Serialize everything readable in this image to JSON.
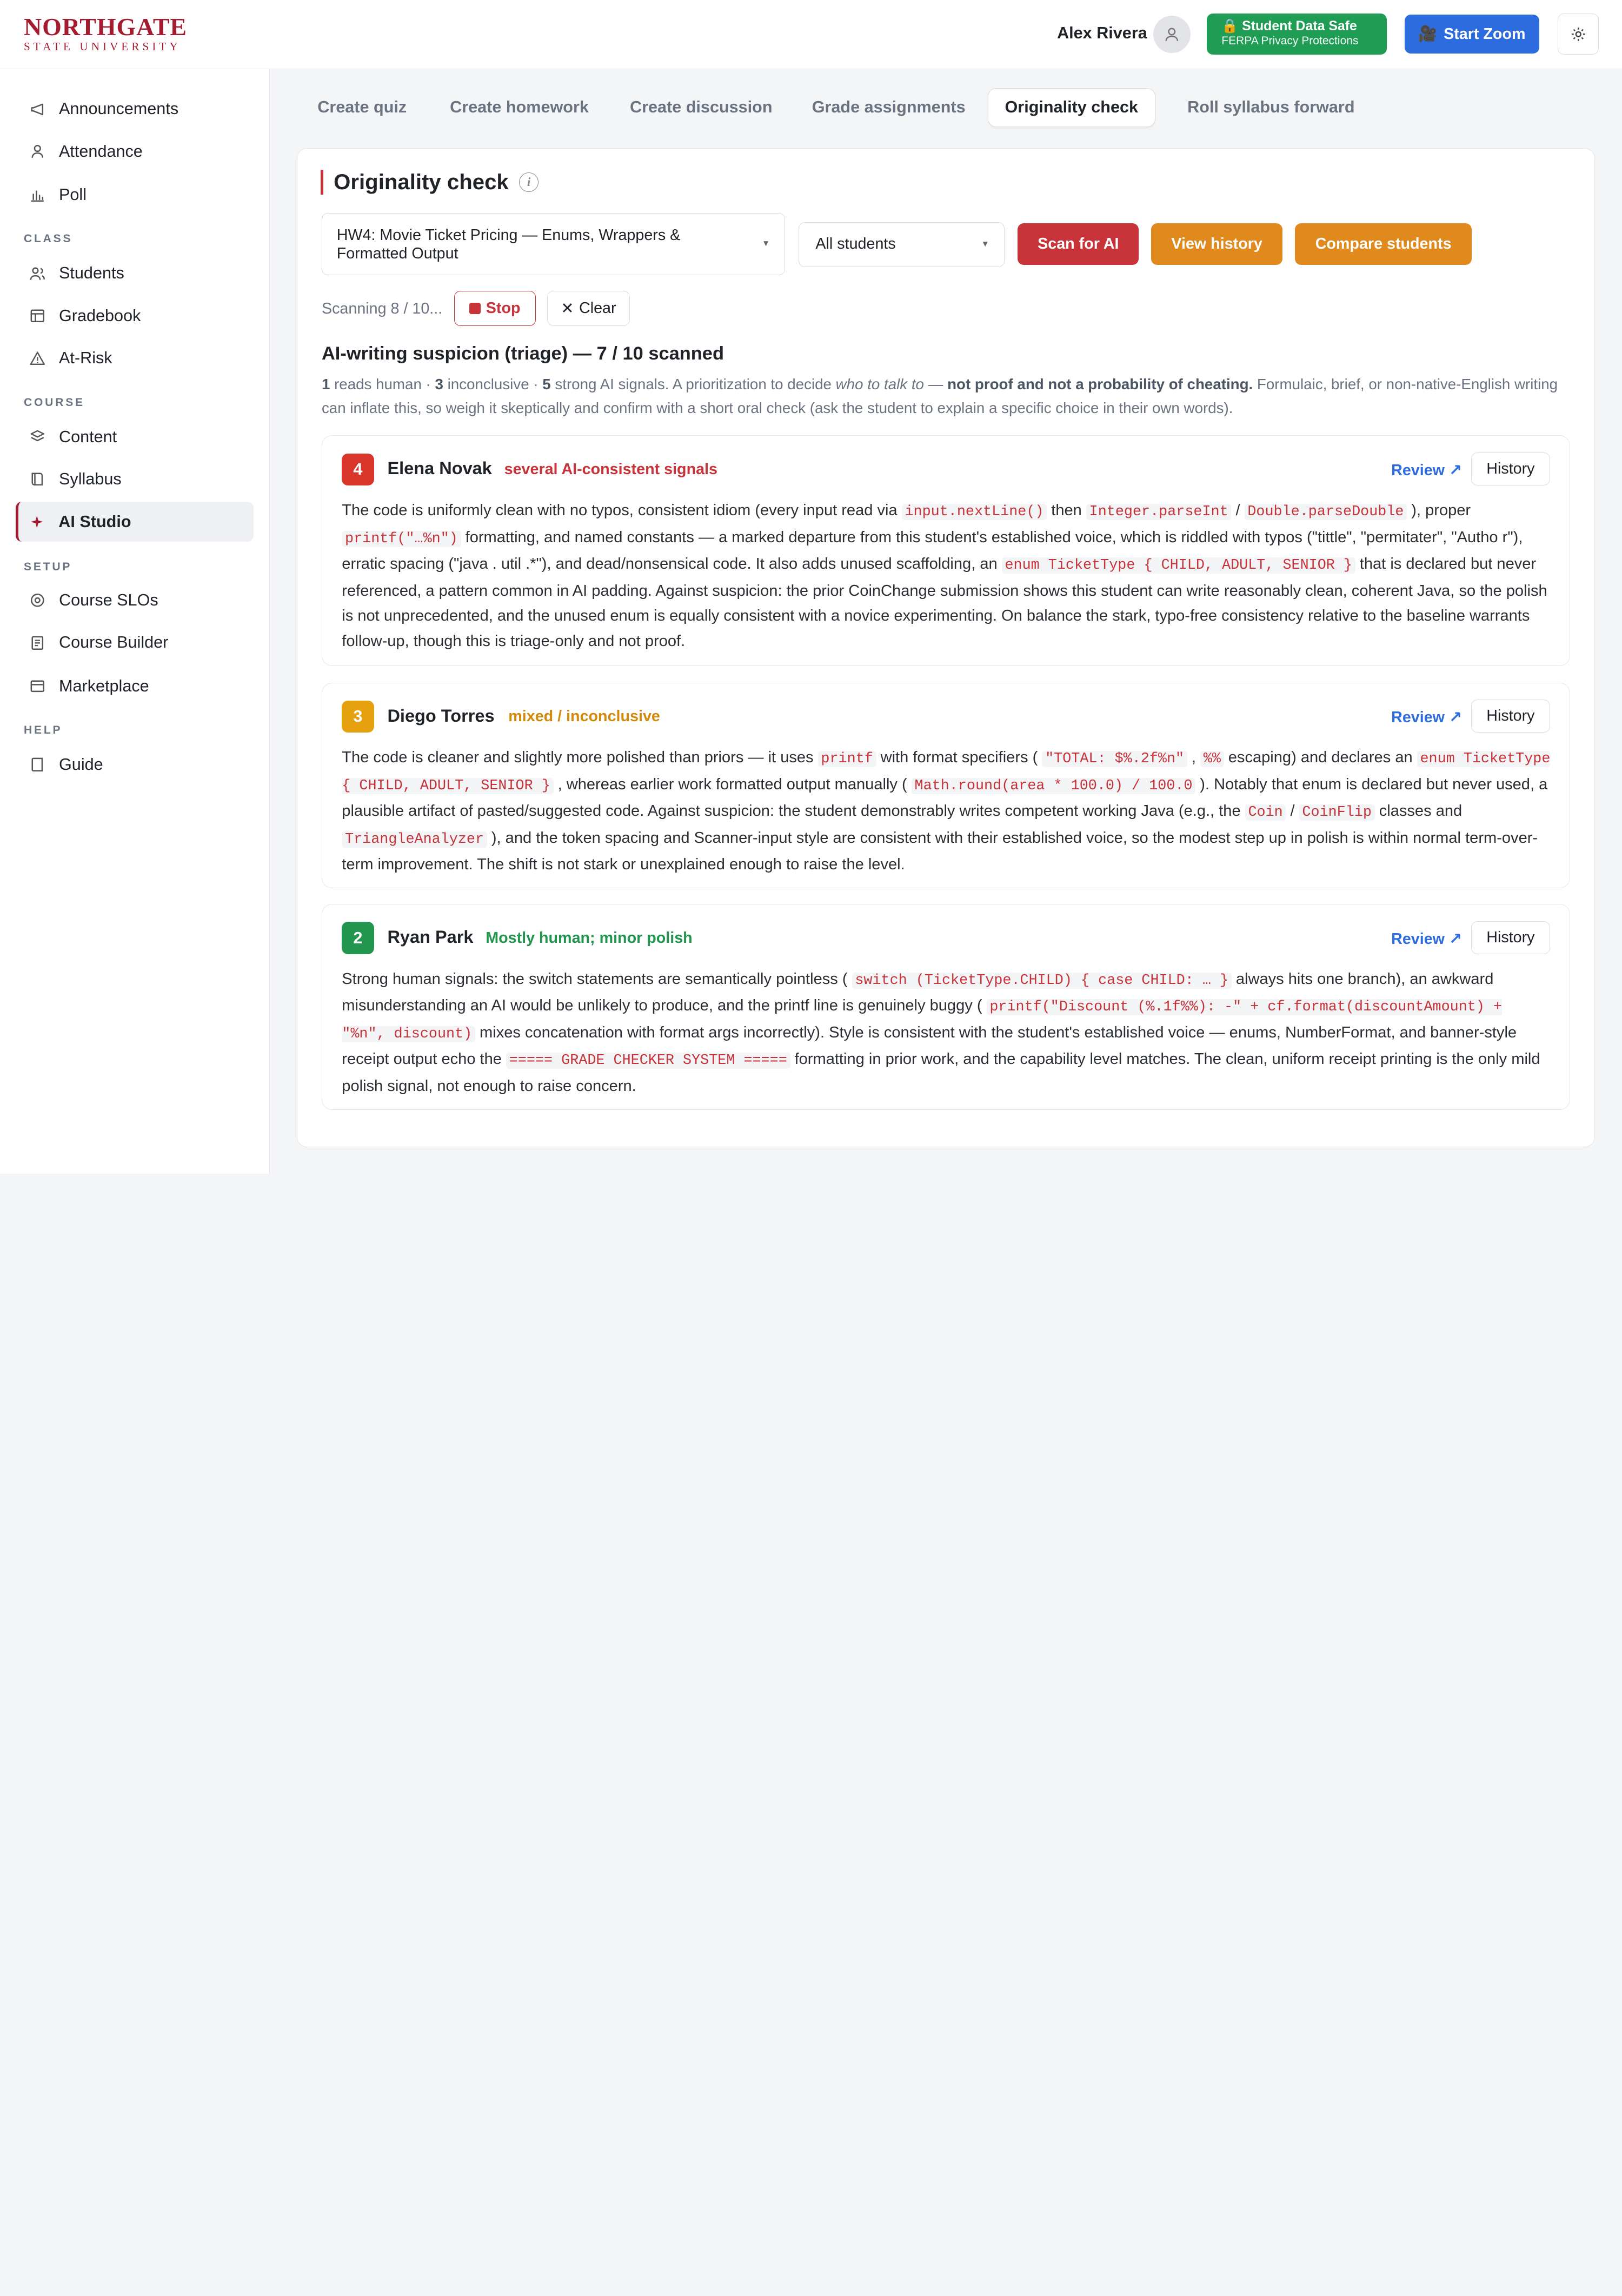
{
  "header": {
    "logo_main": "NORTHGATE",
    "logo_sub": "STATE UNIVERSITY",
    "user_name": "Alex Rivera",
    "ferpa_title": "🔒 Student Data Safe",
    "ferpa_sub": "FERPA Privacy Protections",
    "zoom_label": "Start Zoom"
  },
  "sidebar": {
    "top_items": [
      {
        "label": "Announcements",
        "icon": "megaphone-icon"
      },
      {
        "label": "Attendance",
        "icon": "person-icon"
      },
      {
        "label": "Poll",
        "icon": "bar-chart-icon"
      }
    ],
    "class_label": "CLASS",
    "class_items": [
      {
        "label": "Students",
        "icon": "people-icon"
      },
      {
        "label": "Gradebook",
        "icon": "table-icon"
      },
      {
        "label": "At-Risk",
        "icon": "warning-icon"
      }
    ],
    "course_label": "COURSE",
    "course_items": [
      {
        "label": "Content",
        "icon": "layers-icon"
      },
      {
        "label": "Syllabus",
        "icon": "book-icon"
      },
      {
        "label": "AI Studio",
        "icon": "sparkle-icon"
      }
    ],
    "setup_label": "SETUP",
    "setup_items": [
      {
        "label": "Course SLOs",
        "icon": "target-icon"
      },
      {
        "label": "Course Builder",
        "icon": "document-icon"
      },
      {
        "label": "Marketplace",
        "icon": "store-icon"
      }
    ],
    "help_label": "HELP",
    "help_items": [
      {
        "label": "Guide",
        "icon": "book-icon"
      }
    ]
  },
  "tabs": [
    "Create quiz",
    "Create homework",
    "Create discussion",
    "Grade assignments",
    "Originality check",
    "Roll syllabus forward"
  ],
  "active_tab": "Originality check",
  "main": {
    "title": "Originality check",
    "assignment_select": "HW4: Movie Ticket Pricing — Enums, Wrappers & Formatted Output",
    "student_select": "All students",
    "scan_btn": "Scan for AI",
    "history_btn": "View history",
    "compare_btn": "Compare students",
    "scan_status": "Scanning 8 / 10...",
    "stop_btn": "Stop",
    "clear_btn": "Clear",
    "triage_title": "AI-writing suspicion (triage) — 7 / 10 scanned",
    "triage_counts": {
      "human": "1",
      "human_label": "reads human",
      "inconclusive": "3",
      "inconclusive_label": "inconclusive",
      "strong": "5",
      "strong_label": "strong AI signals."
    },
    "triage_desc_1": "A prioritization to decide ",
    "triage_desc_em": "who to talk to",
    "triage_desc_2": " — ",
    "triage_desc_bold": "not proof and not a probability of cheating.",
    "triage_desc_3": " Formulaic, brief, or non-native-English writing can inflate this, so weigh it skeptically and confirm with a short oral check (ask the student to explain a specific choice in their own words)."
  },
  "results": [
    {
      "score": "4",
      "name": "Elena Novak",
      "level": "several AI-consistent signals",
      "review": "Review ↗",
      "history": "History",
      "colors": {
        "score": "#d9362b",
        "level": "#c8333a"
      }
    },
    {
      "score": "3",
      "name": "Diego Torres",
      "level": "mixed / inconclusive",
      "review": "Review ↗",
      "history": "History",
      "colors": {
        "score": "#e5a00d",
        "level": "#d4890a"
      }
    },
    {
      "score": "2",
      "name": "Ryan Park",
      "level": "Mostly human; minor polish",
      "review": "Review ↗",
      "history": "History",
      "colors": {
        "score": "#22954f",
        "level": "#22954f"
      }
    }
  ],
  "body1": {
    "t1": "The code is uniformly clean with no typos, consistent idiom (every input read via ",
    "c1": "input.nextLine()",
    "t2": " then ",
    "c2": "Integer.parseInt",
    "t3": " / ",
    "c3": "Double.parseDouble",
    "t4": " ), proper ",
    "c4": "printf(\"…%n\")",
    "t5": " formatting, and named constants — a marked departure from this student's established voice, which is riddled with typos (\"tittle\", \"permitater\", \"Autho r\"), erratic spacing (\"java . util .*\"), and dead/nonsensical code. It also adds unused scaffolding, an ",
    "c5": "enum TicketType { CHILD, ADULT, SENIOR }",
    "t6": " that is declared but never referenced, a pattern common in AI padding. Against suspicion: the prior CoinChange submission shows this student can write reasonably clean, coherent Java, so the polish is not unprecedented, and the unused enum is equally consistent with a novice experimenting. On balance the stark, typo-free consistency relative to the baseline warrants follow-up, though this is triage-only and not proof."
  },
  "body2": {
    "t1": "The code is cleaner and slightly more polished than priors — it uses ",
    "c1": "printf",
    "t2": " with format specifiers ( ",
    "c2": "\"TOTAL: $%.2f%n\"",
    "t3": " , ",
    "c3": "%%",
    "t4": " escaping) and declares an ",
    "c4": "enum TicketType { CHILD, ADULT, SENIOR }",
    "t5": " , whereas earlier work formatted output manually ( ",
    "c5": "Math.round(area * 100.0) / 100.0",
    "t6": " ). Notably that enum is declared but never used, a plausible artifact of pasted/suggested code. Against suspicion: the student demonstrably writes competent working Java (e.g., the ",
    "c6": "Coin",
    "t7": " / ",
    "c7": "CoinFlip",
    "t8": " classes and ",
    "c8": "TriangleAnalyzer",
    "t9": " ), and the token spacing and Scanner-input style are consistent with their established voice, so the modest step up in polish is within normal term-over-term improvement. The shift is not stark or unexplained enough to raise the level."
  },
  "body3": {
    "t1": "Strong human signals: the switch statements are semantically pointless ( ",
    "c1": "switch (TicketType.CHILD) { case CHILD: … }",
    "t2": " always hits one branch), an awkward misunderstanding an AI would be unlikely to produce, and the printf line is genuinely buggy ( ",
    "c2": "printf(\"Discount (%.1f%%): -\" + cf.format(discountAmount) + \"%n\", discount)",
    "t3": " mixes concatenation with format args incorrectly). Style is consistent with the student's established voice — enums, NumberFormat, and banner-style receipt output echo the ",
    "c3": "===== GRADE CHECKER SYSTEM =====",
    "t4": " formatting in prior work, and the capability level matches. The clean, uniform receipt printing is the only mild polish signal, not enough to raise concern."
  }
}
